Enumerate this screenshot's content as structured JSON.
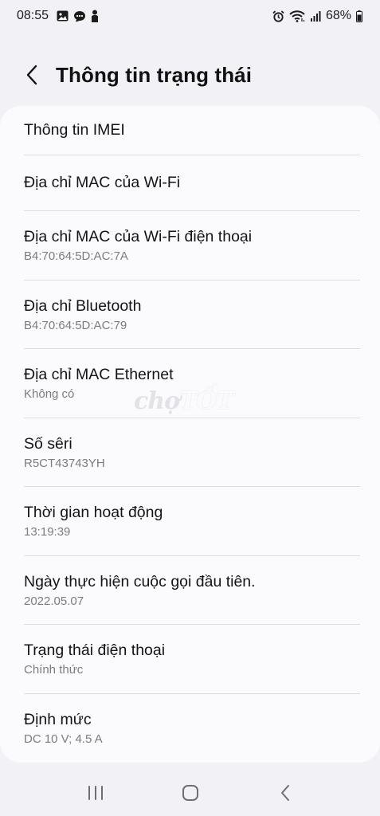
{
  "status_bar": {
    "time": "08:55",
    "battery": "68%",
    "icons_left": [
      "gallery-icon",
      "chat-icon",
      "person-icon"
    ],
    "icons_right": [
      "alarm-icon",
      "wifi-icon",
      "signal-icon",
      "battery-icon"
    ]
  },
  "header": {
    "title": "Thông tin trạng thái"
  },
  "items": [
    {
      "title": "Thông tin IMEI",
      "subtitle": ""
    },
    {
      "title": "Địa chỉ MAC của Wi-Fi",
      "subtitle": ""
    },
    {
      "title": "Địa chỉ MAC của Wi-Fi điện thoại",
      "subtitle": "B4:70:64:5D:AC:7A"
    },
    {
      "title": "Địa chỉ Bluetooth",
      "subtitle": "B4:70:64:5D:AC:79"
    },
    {
      "title": "Địa chỉ MAC Ethernet",
      "subtitle": "Không có"
    },
    {
      "title": "Số sêri",
      "subtitle": "R5CT43743YH"
    },
    {
      "title": "Thời gian hoạt động",
      "subtitle": "13:19:39"
    },
    {
      "title": "Ngày thực hiện cuộc gọi đầu tiên.",
      "subtitle": "2022.05.07"
    },
    {
      "title": "Trạng thái điện thoại",
      "subtitle": "Chính thức"
    },
    {
      "title": "Định mức",
      "subtitle": "DC 10 V; 4.5 A"
    }
  ],
  "watermark": {
    "text_1": "chợ",
    "text_2": "TỐT"
  },
  "nav": {
    "recents": "recents-icon",
    "home": "home-icon",
    "back": "back-icon"
  }
}
